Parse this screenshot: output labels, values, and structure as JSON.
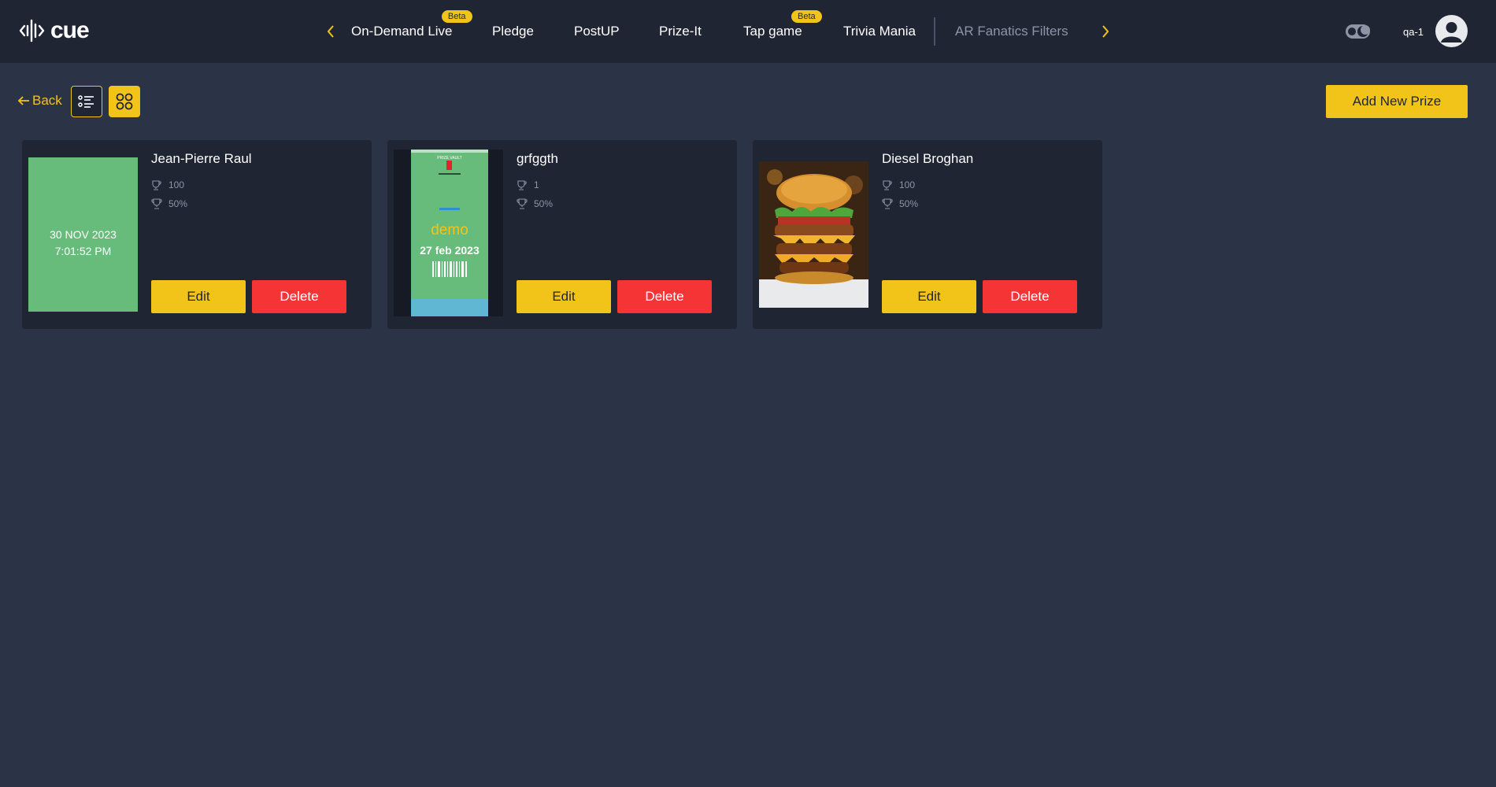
{
  "app": {
    "brand": "cue"
  },
  "nav": {
    "items": [
      {
        "label": "On-Demand Live",
        "badge": "Beta"
      },
      {
        "label": "Pledge"
      },
      {
        "label": "PostUP"
      },
      {
        "label": "Prize-It"
      },
      {
        "label": "Tap game",
        "badge": "Beta"
      },
      {
        "label": "Trivia Mania"
      },
      {
        "label": "AR Fanatics Filters"
      }
    ]
  },
  "user": {
    "name": "qa-1"
  },
  "toolbar": {
    "back_label": "Back",
    "add_label": "Add New Prize",
    "active_view": "grid"
  },
  "prizes": [
    {
      "title": "Jean-Pierre Raul",
      "quantity": "100",
      "probability": "50%",
      "image_text": {
        "date": "30 NOV 2023",
        "time": "7:01:52 PM"
      },
      "edit_label": "Edit",
      "delete_label": "Delete"
    },
    {
      "title": "grfggth",
      "quantity": "1",
      "probability": "50%",
      "image_text": {
        "header": "PRIZE VAULT",
        "brand": "demo",
        "date": "27 feb 2023"
      },
      "edit_label": "Edit",
      "delete_label": "Delete"
    },
    {
      "title": "Diesel Broghan",
      "quantity": "100",
      "probability": "50%",
      "edit_label": "Edit",
      "delete_label": "Delete"
    }
  ],
  "colors": {
    "accent": "#f2c41a",
    "danger": "#f53535",
    "background": "#2b3447",
    "surface": "#1f2533"
  }
}
